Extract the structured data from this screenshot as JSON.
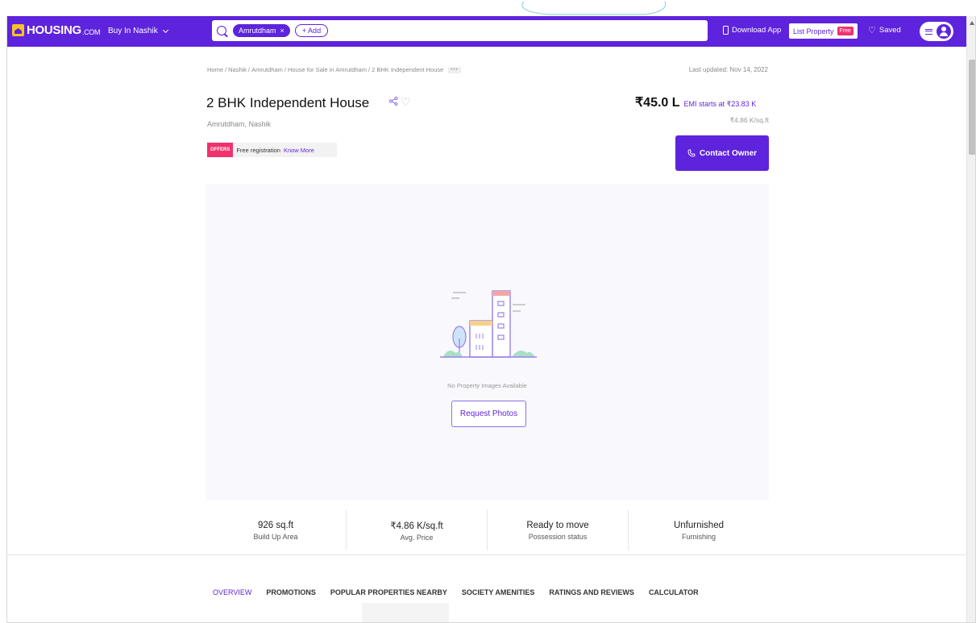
{
  "header": {
    "logo_text": "HOUSING",
    "logo_suffix": ".COM",
    "city_label": "Buy In Nashik",
    "search_chip": "Amrutdham",
    "search_chip_close": "×",
    "add_label": "+ Add",
    "download_app": "Download App",
    "list_property": "List Property",
    "free_badge": "Free",
    "saved_label": "Saved",
    "brand_color": "#5e23dc"
  },
  "breadcrumb": {
    "items": [
      "Home",
      "Nashik",
      "Amrutdham",
      "House for Sale in Amrutdham",
      "2 BHK Independent House"
    ],
    "more": "•••"
  },
  "listing": {
    "last_updated": "Last updated: Nov 14, 2022",
    "title": "2 BHK Independent House",
    "locality": "Amrutdham, Nashik",
    "offers_badge": "OFFERS",
    "offers_text": "Free registration",
    "offers_link": "Know More",
    "price": "₹45.0 L",
    "emi": "EMI starts at ₹23.83 K",
    "price_per_sqft": "₹4.86 K/sq.ft",
    "contact_button": "Contact Owner",
    "no_images_text": "No Property Images Available",
    "request_photos": "Request Photos"
  },
  "stats": [
    {
      "value": "926 sq.ft",
      "label": "Build Up Area"
    },
    {
      "value": "₹4.86 K/sq.ft",
      "label": "Avg. Price"
    },
    {
      "value": "Ready to move",
      "label": "Possession status"
    },
    {
      "value": "Unfurnished",
      "label": "Furnishing"
    }
  ],
  "tabs": [
    "OVERVIEW",
    "PROMOTIONS",
    "POPULAR PROPERTIES NEARBY",
    "SOCIETY AMENITIES",
    "RATINGS AND REVIEWS",
    "CALCULATOR"
  ],
  "icons": {
    "logo": "housing-logo-icon",
    "search": "search-icon",
    "download": "phone-icon",
    "saved": "heart-icon",
    "menu": "hamburger-icon",
    "user": "user-avatar-icon",
    "share": "share-icon",
    "favorite": "heart-icon",
    "contact": "phone-call-icon",
    "placeholder": "building-illustration-icon"
  }
}
